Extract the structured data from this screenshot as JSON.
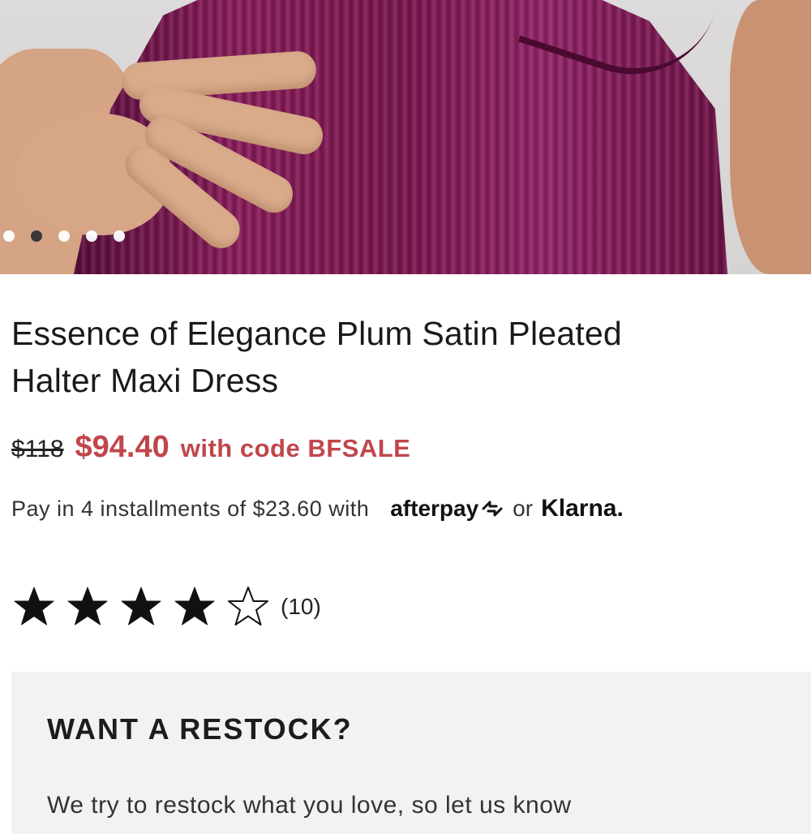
{
  "gallery": {
    "image_alt": "Plum satin pleated halter maxi dress",
    "dots_count": 5,
    "active_dot_index": 1
  },
  "product": {
    "title_line1": "Essence of Elegance Plum Satin Pleated",
    "title_line2": "Halter Maxi Dress",
    "original_price": "$118",
    "sale_price": "$94.40",
    "sale_note": "with code BFSALE",
    "sale_color": "#c0464b"
  },
  "installments": {
    "text": "Pay in 4 installments of $23.60 with",
    "afterpay_label": "afterpay",
    "afterpay_icon": "afterpay-loop-icon",
    "or_text": "or",
    "klarna_label": "Klarna."
  },
  "rating": {
    "stars_filled": 4,
    "stars_total": 5,
    "count_label": "(10)"
  },
  "restock": {
    "title": "WANT A RESTOCK?",
    "body": "We try to restock what you love, so let us know"
  }
}
